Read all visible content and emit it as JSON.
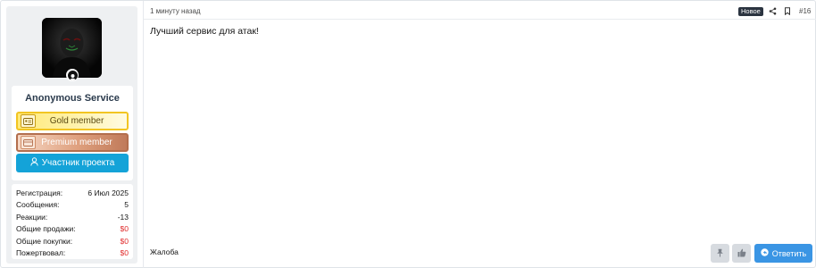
{
  "user": {
    "name": "Anonymous Service",
    "banners": {
      "gold": "Gold member",
      "premium": "Premium member",
      "member": "Участник проекта"
    },
    "stats": [
      {
        "label": "Регистрация:",
        "value": "6 Июл 2025",
        "color": "#141414"
      },
      {
        "label": "Сообщения:",
        "value": "5",
        "color": "#141414"
      },
      {
        "label": "Реакции:",
        "value": "-13",
        "color": "#141414"
      },
      {
        "label": "Общие продажи:",
        "value": "$0",
        "color": "#e02a2a"
      },
      {
        "label": "Общие покупки:",
        "value": "$0",
        "color": "#e02a2a"
      },
      {
        "label": "Пожертвовал:",
        "value": "$0",
        "color": "#e02a2a"
      }
    ]
  },
  "post": {
    "time": "1 минуту назад",
    "new_badge": "Новое",
    "number": "#16",
    "message": "Лучший сервис для атак!",
    "report": "Жалоба",
    "reply": "Ответить"
  },
  "icons": {
    "share": "share-icon",
    "bookmark": "bookmark-icon",
    "pin": "pin-icon",
    "like": "thumbs-up-icon",
    "reply": "reply-icon",
    "online": "user-icon"
  },
  "colors": {
    "accent": "#14a3d8",
    "reply": "#3a95e4",
    "gold": "#f2c522",
    "premium": "#b36e4d",
    "negative": "#e02a2a"
  }
}
